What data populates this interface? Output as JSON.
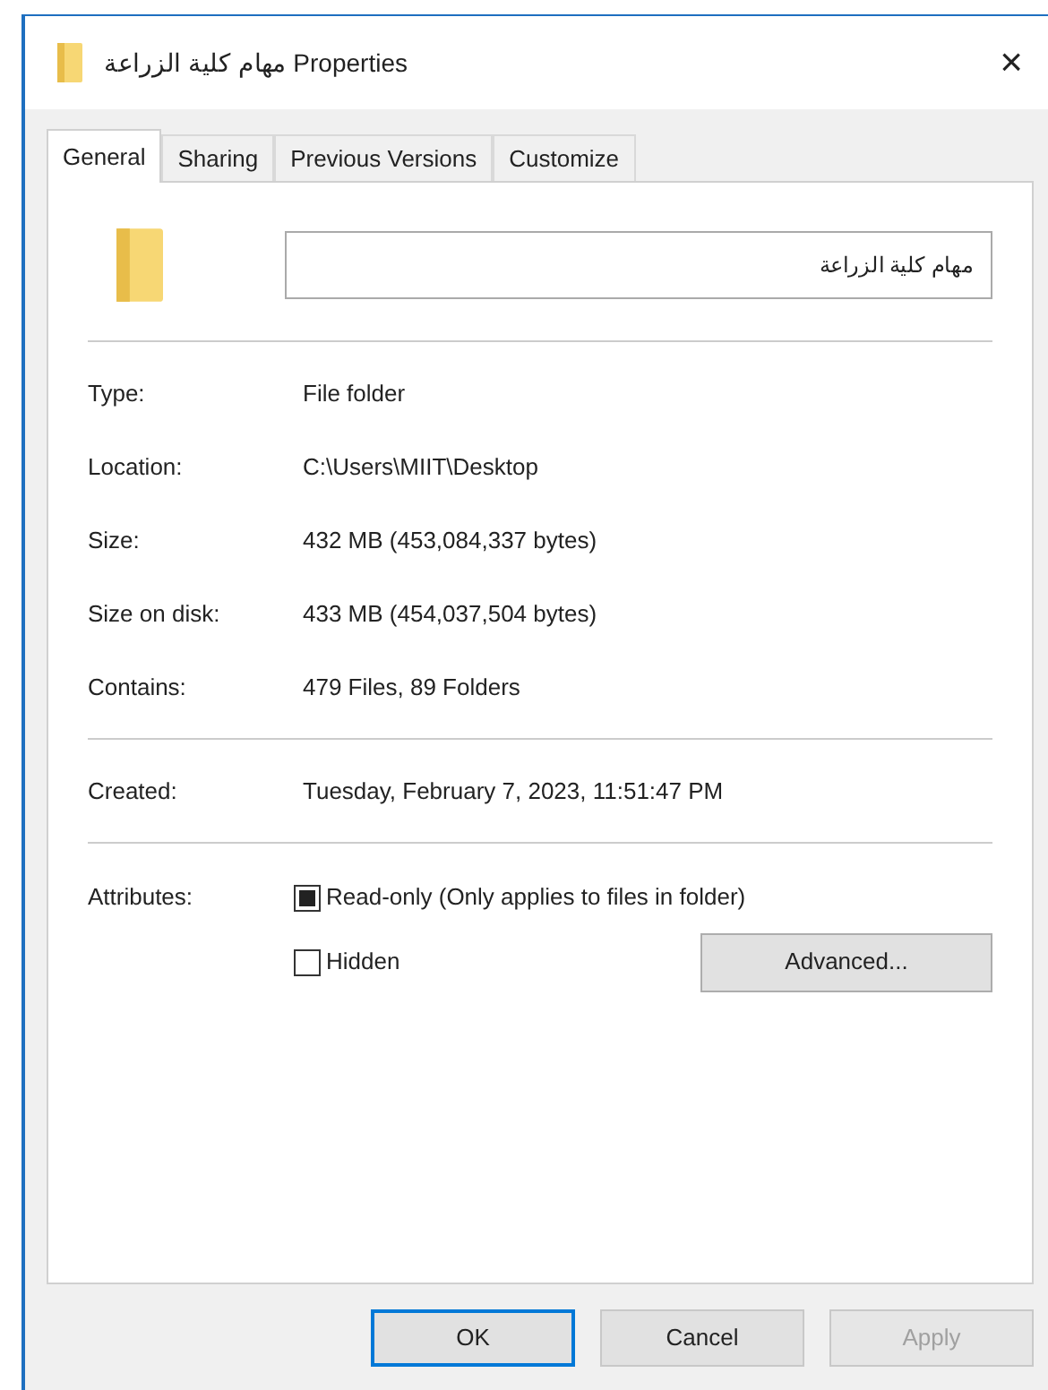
{
  "window": {
    "title": "مهام كلية الزراعة Properties",
    "close": "×"
  },
  "tabs": [
    {
      "label": "General",
      "selected": true
    },
    {
      "label": "Sharing",
      "selected": false
    },
    {
      "label": "Previous Versions",
      "selected": false
    },
    {
      "label": "Customize",
      "selected": false
    }
  ],
  "name_field": {
    "value": "مهام كلية الزراعة"
  },
  "groups": [
    [
      {
        "label": "Type:",
        "value": "File folder"
      },
      {
        "label": "Location:",
        "value": "C:\\Users\\MIIT\\Desktop"
      },
      {
        "label": "Size:",
        "value": "432 MB (453,084,337 bytes)"
      },
      {
        "label": "Size on disk:",
        "value": "433 MB (454,037,504 bytes)"
      },
      {
        "label": "Contains:",
        "value": "479 Files, 89 Folders"
      }
    ],
    [
      {
        "label": "Created:",
        "value": "Tuesday, February 7, 2023, 11:51:47 PM"
      }
    ]
  ],
  "attributes": {
    "label": "Attributes:",
    "items": [
      {
        "label": "Read-only (Only applies to files in folder)",
        "checked": false,
        "indeterminate": true
      },
      {
        "label": "Hidden",
        "checked": false,
        "indeterminate": false
      }
    ],
    "advanced": "Advanced..."
  },
  "buttons": [
    {
      "label": "OK",
      "default": true,
      "disabled": false
    },
    {
      "label": "Cancel",
      "default": false,
      "disabled": false
    },
    {
      "label": "Apply",
      "default": false,
      "disabled": true
    }
  ]
}
